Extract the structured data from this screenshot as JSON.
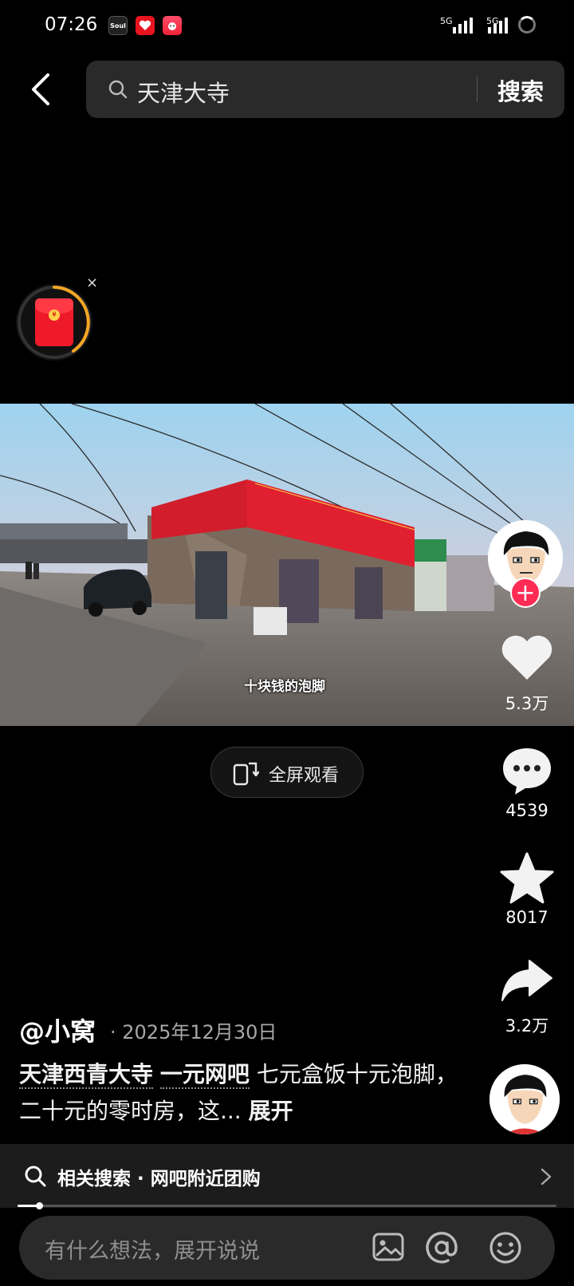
{
  "status_bar": {
    "time": "07:26",
    "app_icons": [
      "soul-app-icon",
      "heart-app-icon",
      "game-app-icon"
    ],
    "app_icon_text": [
      "Soul",
      "",
      ""
    ],
    "network_1": "5G",
    "network_2": "5G"
  },
  "search": {
    "query": "天津大寺",
    "submit_label": "搜索"
  },
  "video": {
    "subtitle": "十块钱的泡脚",
    "fullscreen_label": "全屏观看"
  },
  "actions": {
    "likes": "5.3万",
    "comments": "4539",
    "favorites": "8017",
    "shares": "3.2万"
  },
  "post": {
    "author": "@小窝",
    "date": "· 2025年12月30日",
    "tag_1": "天津西青大寺",
    "tag_2": "一元网吧",
    "text": " 七元盒饭十元泡脚，二十元的零时房，这... ",
    "expand_label": "展开"
  },
  "related": {
    "label": "相关搜索 · 网吧附近团购"
  },
  "playback": {
    "progress": 0.04
  },
  "comment": {
    "placeholder": "有什么想法，展开说说"
  },
  "colors": {
    "accent": "#fe2c55",
    "background": "#000000"
  }
}
